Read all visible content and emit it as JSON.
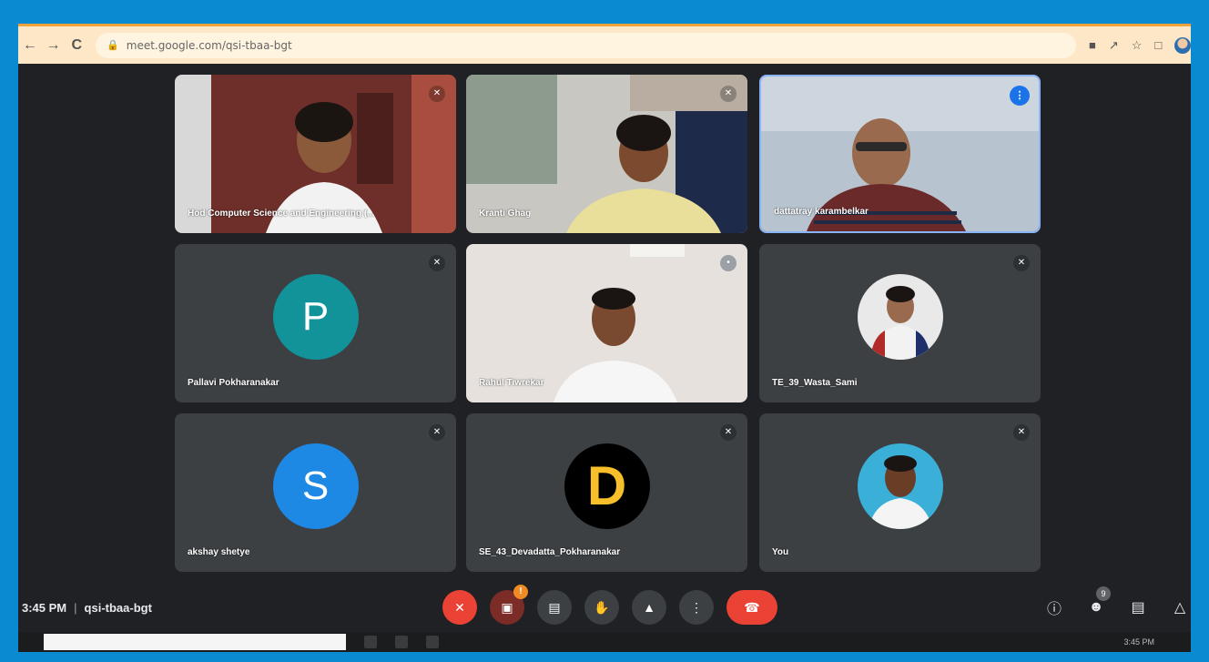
{
  "browser": {
    "url": "meet.google.com/qsi-tbaa-bgt",
    "back_icon": "←",
    "forward_icon": "→",
    "reload_icon": "C"
  },
  "tiles": [
    {
      "name": "Hod Computer Science and Engineering (...",
      "muted": true
    },
    {
      "name": "Kranti Ghag",
      "muted": true
    },
    {
      "name": "dattatray karambelkar",
      "speaking": true
    },
    {
      "name": "Pallavi Pokharanakar",
      "avatar_letter": "P",
      "avatar_color": "#12939a",
      "muted": true
    },
    {
      "name": "Rahul Tiwrekar",
      "muted": false
    },
    {
      "name": "TE_39_Wasta_Sami",
      "muted": true
    },
    {
      "name": "akshay shetye",
      "avatar_letter": "S",
      "avatar_color": "#1e88e5",
      "muted": true
    },
    {
      "name": "SE_43_Devadatta_Pokharanakar",
      "avatar_letter": "D",
      "avatar_color": "#000000",
      "muted": true
    },
    {
      "name": "You",
      "muted": true
    }
  ],
  "meeting": {
    "time": "3:45 PM",
    "separator": "|",
    "code": "qsi-tbaa-bgt"
  },
  "controls": {
    "mic_icon": "mic-off-icon",
    "camera_alert": "!",
    "participants_count": "9"
  },
  "taskbar": {
    "clock": "3:45 PM"
  },
  "colors": {
    "background": "#202124",
    "tile": "#3c4043",
    "red": "#ea4335",
    "speaking_blue": "#1a73e8",
    "frame_blue": "#0a8ad0"
  }
}
